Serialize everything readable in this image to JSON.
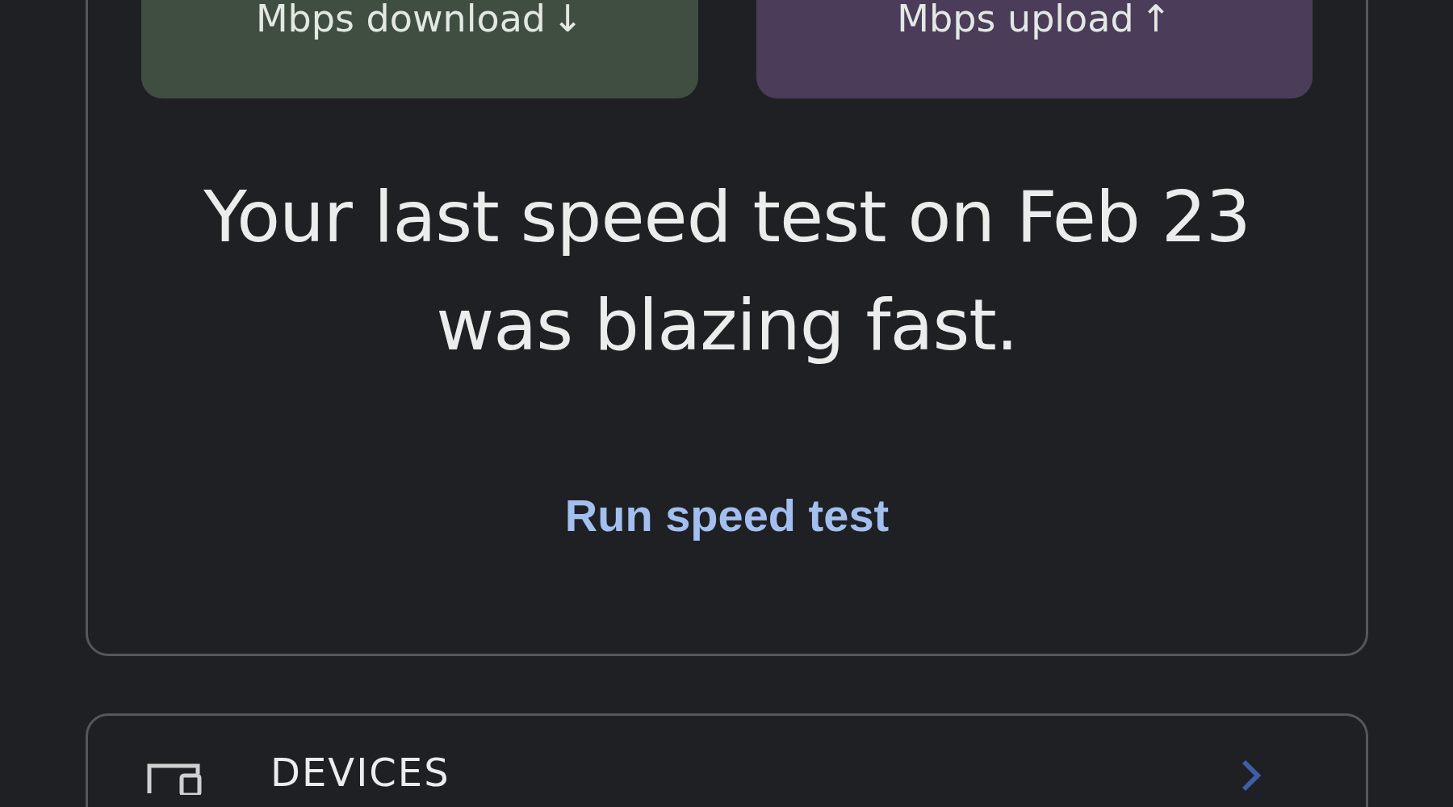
{
  "speed_card": {
    "tiles": [
      {
        "kind": "download",
        "label": "Mbps download",
        "arrow": "↓"
      },
      {
        "kind": "upload",
        "label": "Mbps upload",
        "arrow": "↑"
      }
    ],
    "message": "Your last speed test on Feb 23 was blazing fast.",
    "action": "Run speed test"
  },
  "devices_card": {
    "title": "DEVICES"
  }
}
